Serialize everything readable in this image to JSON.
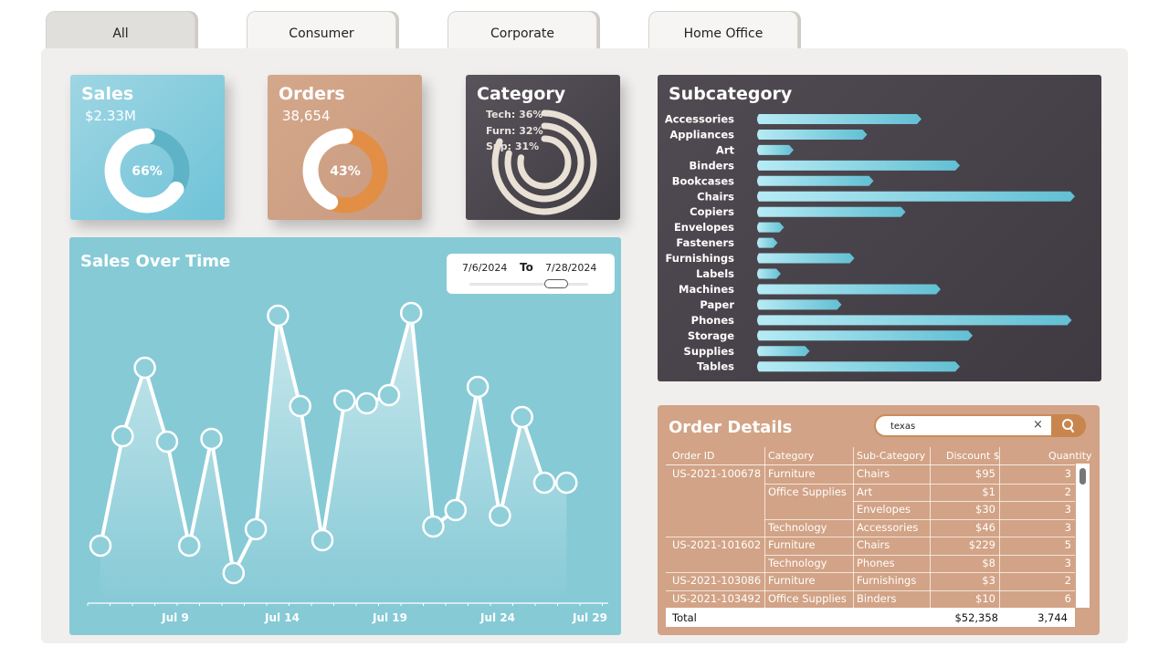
{
  "tabs": [
    {
      "label": "All",
      "active": true
    },
    {
      "label": "Consumer",
      "active": false
    },
    {
      "label": "Corporate",
      "active": false
    },
    {
      "label": "Home Office",
      "active": false
    }
  ],
  "kpis": {
    "sales": {
      "title": "Sales",
      "value": "$2.33M",
      "percent_label": "66%",
      "fraction": 0.66
    },
    "orders": {
      "title": "Orders",
      "value": "38,654",
      "percent_label": "43%",
      "fraction": 0.43
    },
    "category": {
      "title": "Category",
      "items": [
        {
          "label": "Tech: 36%",
          "fraction": 0.36
        },
        {
          "label": "Furn: 32%",
          "fraction": 0.32
        },
        {
          "label": "Sup: 31%",
          "fraction": 0.31
        }
      ]
    }
  },
  "subcategory": {
    "title": "Subcategory",
    "bars": [
      {
        "label": "Accessories",
        "value": 0.52
      },
      {
        "label": "Appliances",
        "value": 0.35
      },
      {
        "label": "Art",
        "value": 0.12
      },
      {
        "label": "Binders",
        "value": 0.64
      },
      {
        "label": "Bookcases",
        "value": 0.37
      },
      {
        "label": "Chairs",
        "value": 1.0
      },
      {
        "label": "Copiers",
        "value": 0.47
      },
      {
        "label": "Envelopes",
        "value": 0.09
      },
      {
        "label": "Fasteners",
        "value": 0.07
      },
      {
        "label": "Furnishings",
        "value": 0.31
      },
      {
        "label": "Labels",
        "value": 0.08
      },
      {
        "label": "Machines",
        "value": 0.58
      },
      {
        "label": "Paper",
        "value": 0.27
      },
      {
        "label": "Phones",
        "value": 0.99
      },
      {
        "label": "Storage",
        "value": 0.68
      },
      {
        "label": "Supplies",
        "value": 0.17
      },
      {
        "label": "Tables",
        "value": 0.64
      }
    ]
  },
  "sales_over_time": {
    "title": "Sales Over Time",
    "date_from": "7/6/2024",
    "to_label": "To",
    "date_to": "7/28/2024",
    "x_labels": [
      "Jul 9",
      "Jul 14",
      "Jul 19",
      "Jul 24",
      "Jul 29"
    ],
    "points": [
      0.15,
      0.55,
      0.8,
      0.53,
      0.15,
      0.54,
      0.05,
      0.21,
      0.99,
      0.66,
      0.17,
      0.68,
      0.67,
      0.7,
      1.0,
      0.22,
      0.28,
      0.73,
      0.26,
      0.62,
      0.38,
      0.38
    ]
  },
  "order_details": {
    "title": "Order Details",
    "search_value": "texas",
    "clear_label": "×",
    "columns": [
      "Order ID",
      "Category",
      "Sub-Category",
      "Discount $",
      "Quantity"
    ],
    "rows": [
      {
        "order_id": "US-2021-100678",
        "category": "Furniture",
        "subcategory": "Chairs",
        "discount": "$95",
        "qty": "3"
      },
      {
        "order_id": "",
        "category": "Office Supplies",
        "subcategory": "Art",
        "discount": "$1",
        "qty": "2"
      },
      {
        "order_id": "",
        "category": "",
        "subcategory": "Envelopes",
        "discount": "$30",
        "qty": "3"
      },
      {
        "order_id": "",
        "category": "Technology",
        "subcategory": "Accessories",
        "discount": "$46",
        "qty": "3"
      },
      {
        "order_id": "US-2021-101602",
        "category": "Furniture",
        "subcategory": "Chairs",
        "discount": "$229",
        "qty": "5"
      },
      {
        "order_id": "",
        "category": "Technology",
        "subcategory": "Phones",
        "discount": "$8",
        "qty": "3"
      },
      {
        "order_id": "US-2021-103086",
        "category": "Furniture",
        "subcategory": "Furnishings",
        "discount": "$3",
        "qty": "2"
      },
      {
        "order_id": "US-2021-103492",
        "category": "Office Supplies",
        "subcategory": "Binders",
        "discount": "$10",
        "qty": "6"
      }
    ],
    "total": {
      "label": "Total",
      "discount": "$52,358",
      "qty": "3,744"
    }
  },
  "colors": {
    "sales_ring": "#ffffff",
    "sales_track": "#5fb3c6",
    "orders_ring": "#ffffff",
    "orders_track": "#e28e45",
    "category_ring": "#e9e1d6",
    "bar_start": "#b6ebf5",
    "bar_end": "#62bfd3",
    "line": "#ffffff"
  }
}
